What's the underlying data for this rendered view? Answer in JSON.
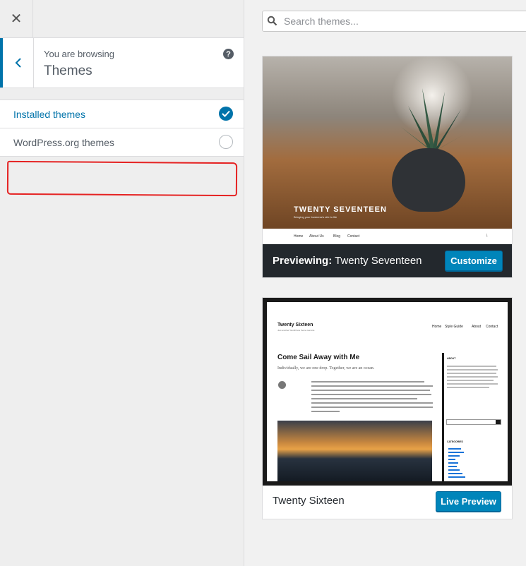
{
  "sidebar": {
    "close_label": "✕",
    "browsing_sub": "You are browsing",
    "browsing_title": "Themes",
    "help_label": "?",
    "filters": [
      {
        "label": "Installed themes",
        "checked": true
      },
      {
        "label": "WordPress.org themes",
        "checked": false
      }
    ]
  },
  "search": {
    "placeholder": "Search themes..."
  },
  "themes": [
    {
      "preview_title": "TWENTY SEVENTEEN",
      "preview_tagline": "Bringing your business's site to life",
      "nav": [
        "Home",
        "About Us",
        "Blog",
        "Contact"
      ],
      "previewing_prefix": "Previewing:",
      "name": "Twenty Seventeen",
      "button": "Customize"
    },
    {
      "site_title": "Twenty Sixteen",
      "site_tagline": "Just another WordPress theme test site",
      "menu": [
        "Home",
        "Style Guide",
        "About",
        "Contact"
      ],
      "post_title": "Come Sail Away with Me",
      "post_subtitle": "Individually, we are one drop. Together, we are an ocean.",
      "sidebar_headings": [
        "ABOUT",
        "CATEGORIES"
      ],
      "name": "Twenty Sixteen",
      "button": "Live Preview"
    }
  ],
  "colors": {
    "accent": "#0073aa",
    "button": "#0085ba",
    "dark_footer": "#23282d",
    "annotation": "#e52222"
  }
}
